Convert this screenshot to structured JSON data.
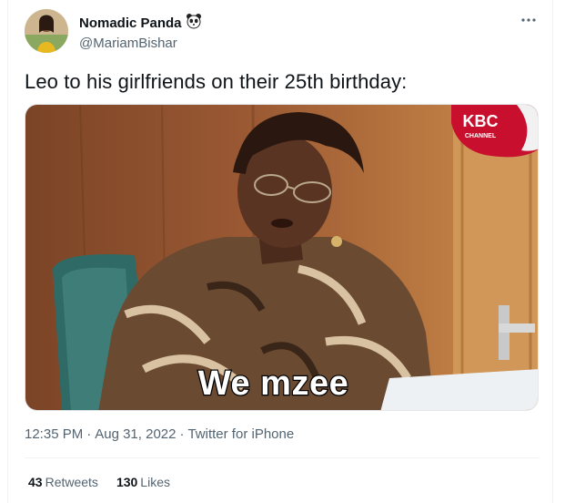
{
  "author": {
    "display_name": "Nomadic Panda",
    "handle": "@MariamBishar",
    "emoji_icon": "panda-face-icon",
    "avatar_icon": "avatar"
  },
  "tweet": {
    "text": "Leo to his girlfriends on their 25th birthday:",
    "media": {
      "caption": "We mzee",
      "logo_text_top": "KBC",
      "logo_text_bottom": "CHANNEL"
    }
  },
  "meta": {
    "time": "12:35 PM",
    "date": "Aug 31, 2022",
    "separator": "·",
    "source": "Twitter for iPhone"
  },
  "stats": {
    "retweets_count": "43",
    "retweets_label": "Retweets",
    "likes_count": "130",
    "likes_label": "Likes"
  },
  "colors": {
    "text_primary": "#0f1419",
    "text_secondary": "#536471",
    "divider": "#eff3f4",
    "kbc_red": "#c8102e"
  }
}
